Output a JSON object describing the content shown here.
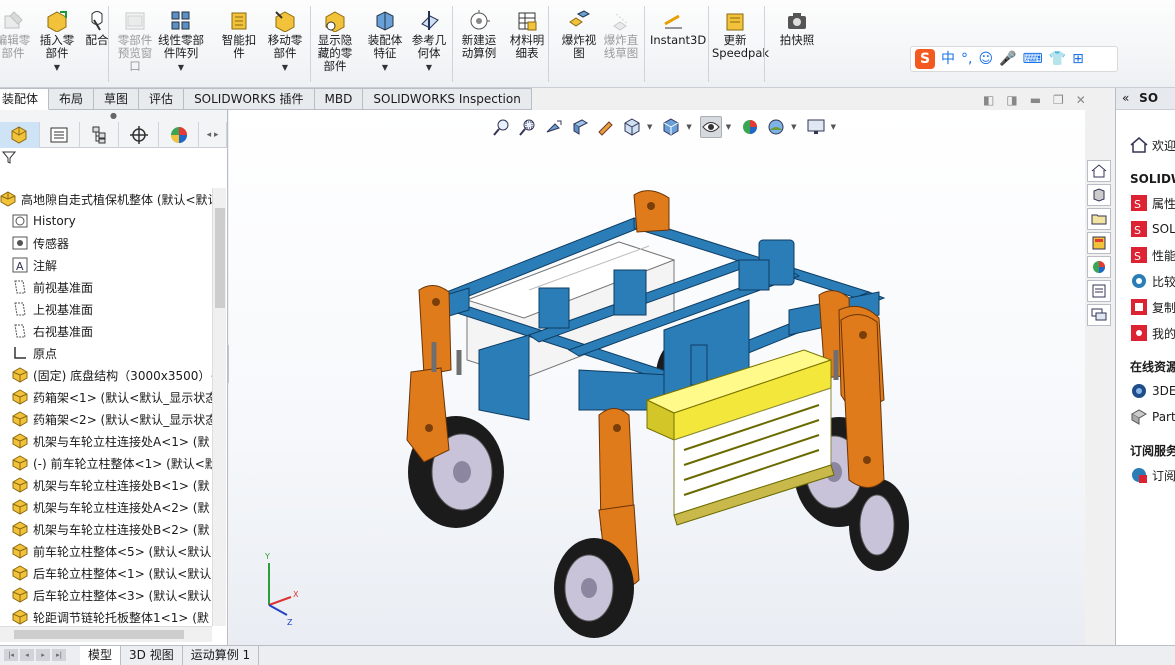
{
  "ribbon": {
    "buttons": [
      {
        "label1": "编辑零",
        "label2": "部件",
        "disabled": true,
        "arrow": false,
        "icon": "edit-component-icon"
      },
      {
        "label1": "插入零",
        "label2": "部件",
        "disabled": false,
        "arrow": true,
        "icon": "insert-component-icon"
      },
      {
        "label1": "配合",
        "label2": "",
        "disabled": false,
        "arrow": false,
        "icon": "mate-icon"
      },
      {
        "label1": "零部件",
        "label2": "预览窗",
        "label3": "口",
        "disabled": true,
        "arrow": false,
        "icon": "preview-window-icon"
      },
      {
        "label1": "线性零部",
        "label2": "件阵列",
        "disabled": false,
        "arrow": true,
        "icon": "linear-pattern-icon"
      },
      {
        "label1": "智能扣",
        "label2": "件",
        "disabled": false,
        "arrow": false,
        "icon": "smart-fastener-icon"
      },
      {
        "label1": "移动零",
        "label2": "部件",
        "disabled": false,
        "arrow": true,
        "icon": "move-component-icon"
      },
      {
        "label1": "显示隐",
        "label2": "藏的零",
        "label3": "部件",
        "disabled": false,
        "arrow": false,
        "icon": "show-hidden-icon"
      },
      {
        "label1": "装配体",
        "label2": "特征",
        "disabled": false,
        "arrow": true,
        "icon": "assembly-feature-icon"
      },
      {
        "label1": "参考几",
        "label2": "何体",
        "disabled": false,
        "arrow": true,
        "icon": "reference-geometry-icon"
      },
      {
        "label1": "新建运",
        "label2": "动算例",
        "disabled": false,
        "arrow": false,
        "icon": "motion-study-icon"
      },
      {
        "label1": "材料明",
        "label2": "细表",
        "disabled": false,
        "arrow": false,
        "icon": "bom-icon"
      },
      {
        "label1": "爆炸视",
        "label2": "图",
        "disabled": false,
        "arrow": false,
        "icon": "exploded-view-icon"
      },
      {
        "label1": "爆炸直",
        "label2": "线草图",
        "disabled": true,
        "arrow": false,
        "icon": "explode-line-icon"
      },
      {
        "label1": "Instant3D",
        "label2": "",
        "disabled": false,
        "arrow": false,
        "icon": "instant3d-icon"
      },
      {
        "label1": "更新",
        "label2": "Speedpak",
        "disabled": false,
        "arrow": false,
        "icon": "speedpak-icon"
      },
      {
        "label1": "拍快照",
        "label2": "",
        "disabled": false,
        "arrow": false,
        "icon": "snapshot-icon"
      }
    ]
  },
  "sogou": {
    "logo": "S",
    "items": [
      "中",
      "°,",
      "☺",
      "🎤",
      "⌨",
      "👕",
      "⊞"
    ]
  },
  "tabs": [
    "装配体",
    "布局",
    "草图",
    "评估",
    "SOLIDWORKS 插件",
    "MBD",
    "SOLIDWORKS Inspection"
  ],
  "tree": {
    "grip": "●",
    "nodes": [
      {
        "label": "高地隙自走式植保机整体  (默认<默认",
        "icon": "assembly-icon",
        "indent": 0
      },
      {
        "label": "History",
        "icon": "history-icon",
        "indent": 1
      },
      {
        "label": "传感器",
        "icon": "sensor-icon",
        "indent": 1
      },
      {
        "label": "注解",
        "icon": "annotation-icon",
        "indent": 1
      },
      {
        "label": "前视基准面",
        "icon": "plane-icon",
        "indent": 1
      },
      {
        "label": "上视基准面",
        "icon": "plane-icon",
        "indent": 1
      },
      {
        "label": "右视基准面",
        "icon": "plane-icon",
        "indent": 1
      },
      {
        "label": "原点",
        "icon": "origin-icon",
        "indent": 1
      },
      {
        "label": "(固定) 底盘结构（3000x3500）<",
        "icon": "part-icon",
        "indent": 1
      },
      {
        "label": "药箱架<1> (默认<默认_显示状态",
        "icon": "part-icon",
        "indent": 1
      },
      {
        "label": "药箱架<2> (默认<默认_显示状态",
        "icon": "part-icon",
        "indent": 1
      },
      {
        "label": "机架与车轮立柱连接处A<1> (默",
        "icon": "part-icon",
        "indent": 1
      },
      {
        "label": "(-) 前车轮立柱整体<1> (默认<默",
        "icon": "part-icon",
        "indent": 1
      },
      {
        "label": "机架与车轮立柱连接处B<1> (默",
        "icon": "part-icon",
        "indent": 1
      },
      {
        "label": "机架与车轮立柱连接处A<2> (默",
        "icon": "part-icon",
        "indent": 1
      },
      {
        "label": "机架与车轮立柱连接处B<2> (默",
        "icon": "part-icon",
        "indent": 1
      },
      {
        "label": "前车轮立柱整体<5> (默认<默认",
        "icon": "part-icon",
        "indent": 1
      },
      {
        "label": "后车轮立柱整体<1> (默认<默认",
        "icon": "part-icon",
        "indent": 1
      },
      {
        "label": "后车轮立柱整体<3> (默认<默认",
        "icon": "part-icon",
        "indent": 1
      },
      {
        "label": "轮距调节链轮托板整体1<1> (默",
        "icon": "part-icon",
        "indent": 1
      }
    ]
  },
  "taskpane": {
    "header": "SO",
    "rows": [
      {
        "type": "row",
        "label": "欢迎",
        "icon": "home-icon"
      },
      {
        "type": "title",
        "label": "SOLIDWO"
      },
      {
        "type": "row",
        "label": "属性",
        "icon": "properties-icon"
      },
      {
        "type": "row",
        "label": "SOL",
        "icon": "sw-resource-icon"
      },
      {
        "type": "row",
        "label": "性能",
        "icon": "performance-icon"
      },
      {
        "type": "row",
        "label": "比较",
        "icon": "compare-icon"
      },
      {
        "type": "row",
        "label": "复制",
        "icon": "copy-icon"
      },
      {
        "type": "row",
        "label": "我的",
        "icon": "my-icon"
      },
      {
        "type": "title",
        "label": "在线资源"
      },
      {
        "type": "row",
        "label": "3DE",
        "icon": "3dexperience-icon"
      },
      {
        "type": "row",
        "label": "Part",
        "icon": "partsupply-icon"
      },
      {
        "type": "title",
        "label": "订阅服务"
      },
      {
        "type": "row",
        "label": "订阅",
        "icon": "subscription-icon"
      }
    ]
  },
  "bottom_tabs": [
    "模型",
    "3D 视图",
    "运动算例 1"
  ],
  "colors": {
    "frame": "#2b7db8",
    "column": "#e07b1c",
    "yellow_box": "#f2e73a",
    "tire": "#1b1b1b",
    "hub": "#c9c3d9"
  }
}
